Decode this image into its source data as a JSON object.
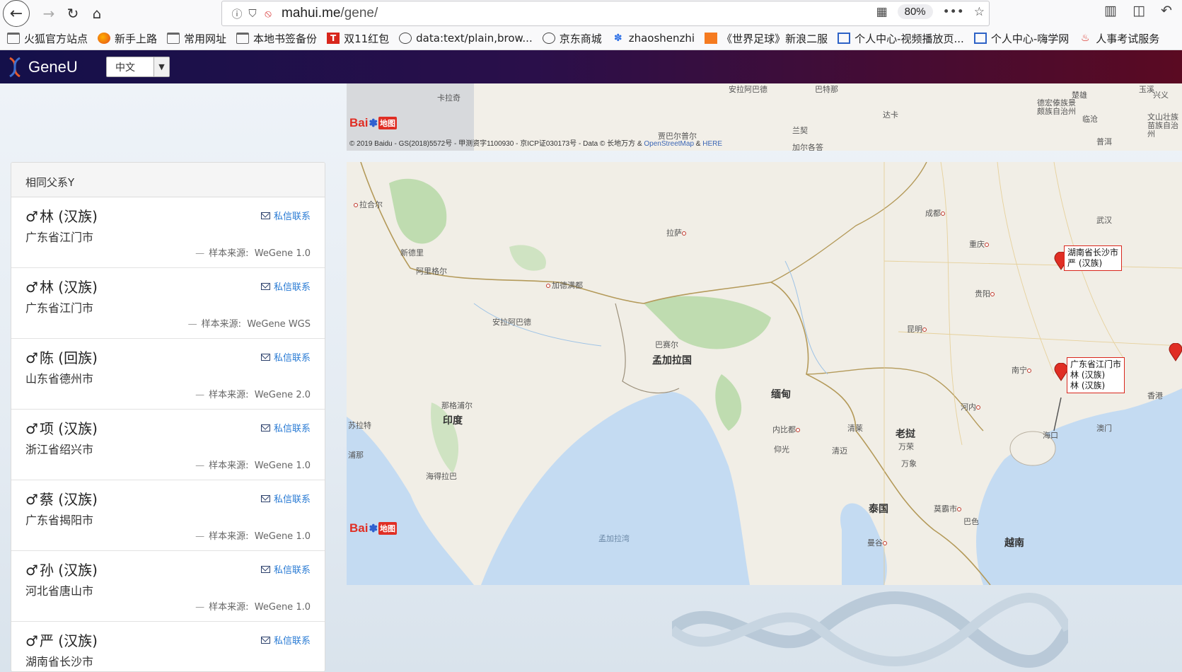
{
  "browser": {
    "url_host": "mahui.me",
    "url_path": "/gene/",
    "zoom": "80%"
  },
  "bookmarks": [
    {
      "label": "火狐官方站点",
      "icon": "folder-icon"
    },
    {
      "label": "新手上路",
      "icon": "firefox-icon"
    },
    {
      "label": "常用网址",
      "icon": "folder-icon"
    },
    {
      "label": "本地书签备份",
      "icon": "folder-icon"
    },
    {
      "label": "双11红包",
      "icon": "tmall-icon"
    },
    {
      "label": "data:text/plain,brow...",
      "icon": "globe-icon"
    },
    {
      "label": "京东商城",
      "icon": "globe-icon"
    },
    {
      "label": "zhaoshenzhi",
      "icon": "paw-icon"
    },
    {
      "label": "《世界足球》新浪二服",
      "icon": "game-icon"
    },
    {
      "label": "个人中心-视频播放页...",
      "icon": "site-icon"
    },
    {
      "label": "个人中心-嗨学网",
      "icon": "site-icon"
    },
    {
      "label": "人事考试服务",
      "icon": "people-icon"
    }
  ],
  "site": {
    "brand": "GeneU",
    "language": "中文"
  },
  "panel": {
    "title": "相同父系Y",
    "contact_label": "私信联系",
    "source_prefix": "样本来源:",
    "matches": [
      {
        "sex": "♂",
        "name": "林 (汉族)",
        "location": "广东省江门市",
        "source": "WeGene 1.0"
      },
      {
        "sex": "♂",
        "name": "林 (汉族)",
        "location": "广东省江门市",
        "source": "WeGene WGS"
      },
      {
        "sex": "♂",
        "name": "陈 (回族)",
        "location": "山东省德州市",
        "source": "WeGene 2.0"
      },
      {
        "sex": "♂",
        "name": "项 (汉族)",
        "location": "浙江省绍兴市",
        "source": "WeGene 1.0"
      },
      {
        "sex": "♂",
        "name": "蔡 (汉族)",
        "location": "广东省揭阳市",
        "source": "WeGene 1.0"
      },
      {
        "sex": "♂",
        "name": "孙 (汉族)",
        "location": "河北省唐山市",
        "source": "WeGene 1.0"
      },
      {
        "sex": "♂",
        "name": "严 (汉族)",
        "location": "湖南省长沙市",
        "source": ""
      }
    ]
  },
  "map": {
    "copyright_main": "© 2019 Baidu - GS(2018)5572号 - 甲测资字1100930 - 京ICP证030173号 - Data © 长地万方 & ",
    "copyright_osm": "OpenStreetMap",
    "copyright_amp": " & ",
    "copyright_here": "HERE",
    "baidu_text": "Bai",
    "baidu_map": "地图",
    "strip_labels": [
      "卡拉奇",
      "安拉阿巴德",
      "巴特那",
      "达卡",
      "兰契",
      "贾巴尔普尔",
      "加尔各答",
      "楚雄",
      "玉溪",
      "德宏傣族景颇族自治州",
      "临沧",
      "普洱",
      "文山壮族苗族自治州",
      "兴义"
    ],
    "cities": [
      "拉合尔",
      "新德里",
      "阿里格尔",
      "加德满都",
      "拉萨",
      "成都",
      "重庆",
      "武汉",
      "贵阳",
      "昆明",
      "安拉阿巴德",
      "巴赛尔",
      "那格浦尔",
      "海得拉巴",
      "内比都",
      "清莱",
      "清迈",
      "万荣",
      "万象",
      "河内",
      "南宁",
      "海口",
      "澳门",
      "香港",
      "仰光",
      "曼谷",
      "莫霸市",
      "巴色",
      "苏拉特",
      "浦那"
    ],
    "countries": [
      "印度",
      "孟加拉国",
      "缅甸",
      "老挝",
      "泰国",
      "越南",
      "孟加拉湾"
    ],
    "popups": [
      {
        "lines": [
          "湖南省长沙市",
          "严 (汉族)"
        ]
      },
      {
        "lines": [
          "广东省江门市",
          "林 (汉族)",
          "林 (汉族)"
        ]
      }
    ]
  },
  "colors": {
    "nav_start": "#14104a",
    "nav_end": "#5a0a22",
    "link": "#2a7bd4",
    "pin": "#e02e24",
    "water": "#c4dbf2",
    "land": "#f1eee6",
    "forest": "#bfdcb0"
  }
}
